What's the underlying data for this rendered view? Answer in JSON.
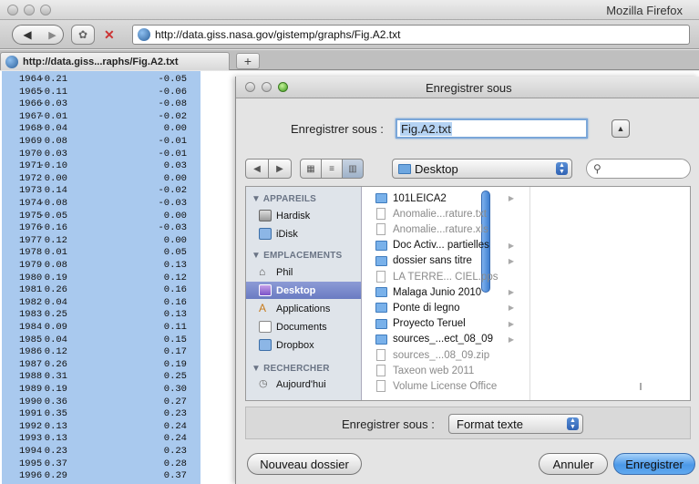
{
  "window": {
    "title": "Mozilla Firefox"
  },
  "nav": {
    "url": "http://data.giss.nasa.gov/gistemp/graphs/Fig.A2.txt",
    "back_icon": "◀",
    "forward_icon": "▶"
  },
  "tabs": {
    "active_label": "http://data.giss...raphs/Fig.A2.txt",
    "new_tab_label": "+"
  },
  "file_rows": [
    {
      "year": "1964",
      "a": "-0.21",
      "b": "-0.05"
    },
    {
      "year": "1965",
      "a": "-0.11",
      "b": "-0.06"
    },
    {
      "year": "1966",
      "a": "-0.03",
      "b": "-0.08"
    },
    {
      "year": "1967",
      "a": "-0.01",
      "b": "-0.02"
    },
    {
      "year": "1968",
      "a": "-0.04",
      "b": "0.00"
    },
    {
      "year": "1969",
      "a": "0.08",
      "b": "-0.01"
    },
    {
      "year": "1970",
      "a": "0.03",
      "b": "-0.01"
    },
    {
      "year": "1971",
      "a": "-0.10",
      "b": "0.03"
    },
    {
      "year": "1972",
      "a": "0.00",
      "b": "0.00"
    },
    {
      "year": "1973",
      "a": "0.14",
      "b": "-0.02"
    },
    {
      "year": "1974",
      "a": "-0.08",
      "b": "-0.03"
    },
    {
      "year": "1975",
      "a": "-0.05",
      "b": "0.00"
    },
    {
      "year": "1976",
      "a": "-0.16",
      "b": "-0.03"
    },
    {
      "year": "1977",
      "a": "0.12",
      "b": "0.00"
    },
    {
      "year": "1978",
      "a": "0.01",
      "b": "0.05"
    },
    {
      "year": "1979",
      "a": "0.08",
      "b": "0.13"
    },
    {
      "year": "1980",
      "a": "0.19",
      "b": "0.12"
    },
    {
      "year": "1981",
      "a": "0.26",
      "b": "0.16"
    },
    {
      "year": "1982",
      "a": "0.04",
      "b": "0.16"
    },
    {
      "year": "1983",
      "a": "0.25",
      "b": "0.13"
    },
    {
      "year": "1984",
      "a": "0.09",
      "b": "0.11"
    },
    {
      "year": "1985",
      "a": "0.04",
      "b": "0.15"
    },
    {
      "year": "1986",
      "a": "0.12",
      "b": "0.17"
    },
    {
      "year": "1987",
      "a": "0.26",
      "b": "0.19"
    },
    {
      "year": "1988",
      "a": "0.31",
      "b": "0.25"
    },
    {
      "year": "1989",
      "a": "0.19",
      "b": "0.30"
    },
    {
      "year": "1990",
      "a": "0.36",
      "b": "0.27"
    },
    {
      "year": "1991",
      "a": "0.35",
      "b": "0.23"
    },
    {
      "year": "1992",
      "a": "0.13",
      "b": "0.24"
    },
    {
      "year": "1993",
      "a": "0.13",
      "b": "0.24"
    },
    {
      "year": "1994",
      "a": "0.23",
      "b": "0.23"
    },
    {
      "year": "1995",
      "a": "0.37",
      "b": "0.28"
    },
    {
      "year": "1996",
      "a": "0.29",
      "b": "0.37"
    }
  ],
  "dialog": {
    "title": "Enregistrer sous",
    "save_as_label": "Enregistrer sous :",
    "filename_value": "Fig.A2.txt",
    "location": "Desktop",
    "search_placeholder": "",
    "sidebar": {
      "devices_heading": "▼ APPAREILS",
      "devices": [
        "Hardisk",
        "iDisk"
      ],
      "places_heading": "▼ EMPLACEMENTS",
      "places": [
        "Phil",
        "Desktop",
        "Applications",
        "Documents",
        "Dropbox"
      ],
      "search_heading": "▼ RECHERCHER",
      "searches": [
        "Aujourd'hui"
      ],
      "selected": "Desktop"
    },
    "files": [
      {
        "name": "101LEICA2",
        "kind": "folder",
        "enabled": true
      },
      {
        "name": "Anomalie...rature.txt",
        "kind": "doc",
        "enabled": false
      },
      {
        "name": "Anomalie...rature.xls",
        "kind": "doc",
        "enabled": false
      },
      {
        "name": "Doc Activ... partielles",
        "kind": "folder",
        "enabled": true
      },
      {
        "name": "dossier sans titre",
        "kind": "folder",
        "enabled": true
      },
      {
        "name": "LA TERRE... CIEL.pps",
        "kind": "doc",
        "enabled": false
      },
      {
        "name": "Malaga Junio 2010",
        "kind": "folder",
        "enabled": true
      },
      {
        "name": "Ponte di legno",
        "kind": "folder",
        "enabled": true
      },
      {
        "name": "Proyecto Teruel",
        "kind": "folder",
        "enabled": true
      },
      {
        "name": "sources_...ect_08_09",
        "kind": "folder",
        "enabled": true
      },
      {
        "name": "sources_...08_09.zip",
        "kind": "doc",
        "enabled": false
      },
      {
        "name": "Taxeon web 2011",
        "kind": "doc",
        "enabled": false
      },
      {
        "name": "Volume License Office",
        "kind": "doc",
        "enabled": false
      }
    ],
    "format_label": "Enregistrer sous :",
    "format_value": "Format texte",
    "new_folder_button": "Nouveau dossier",
    "cancel_button": "Annuler",
    "save_button": "Enregistrer"
  }
}
